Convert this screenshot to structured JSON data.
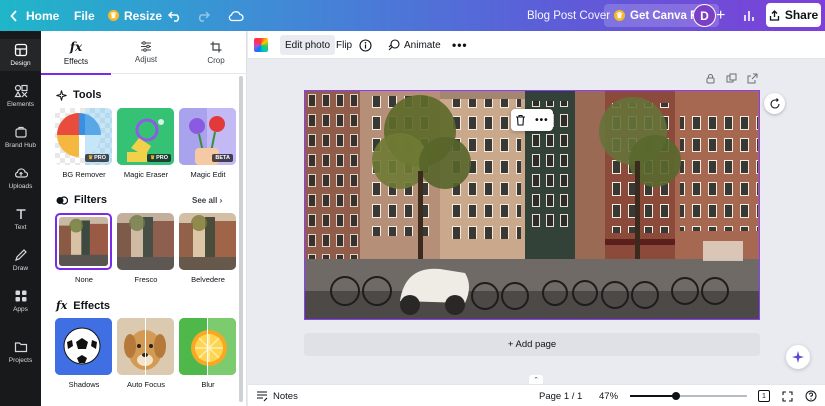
{
  "topbar": {
    "home": "Home",
    "file": "File",
    "resize": "Resize",
    "title": "Blog Post Cover",
    "get_pro": "Get Canva Pro",
    "avatar": "D",
    "share": "Share"
  },
  "rail": {
    "items": [
      {
        "label": "Design",
        "icon": "design-icon"
      },
      {
        "label": "Elements",
        "icon": "elements-icon"
      },
      {
        "label": "Brand Hub",
        "icon": "brand-hub-icon"
      },
      {
        "label": "Uploads",
        "icon": "upload-icon"
      },
      {
        "label": "Text",
        "icon": "text-icon"
      },
      {
        "label": "Draw",
        "icon": "draw-icon"
      },
      {
        "label": "Apps",
        "icon": "apps-icon"
      },
      {
        "label": "Projects",
        "icon": "folder-icon"
      }
    ]
  },
  "panel": {
    "tabs": [
      {
        "label": "Effects",
        "icon": "fx-icon"
      },
      {
        "label": "Adjust",
        "icon": "sliders-icon"
      },
      {
        "label": "Crop",
        "icon": "crop-icon"
      }
    ],
    "tools_title": "Tools",
    "tools": [
      {
        "label": "BG Remover",
        "badge": "PRO"
      },
      {
        "label": "Magic Eraser",
        "badge": "PRO"
      },
      {
        "label": "Magic Edit",
        "badge": "BETA"
      }
    ],
    "filters_title": "Filters",
    "see_all": "See all",
    "filters": [
      {
        "label": "None"
      },
      {
        "label": "Fresco"
      },
      {
        "label": "Belvedere"
      }
    ],
    "effects_title": "Effects",
    "effects": [
      {
        "label": "Shadows"
      },
      {
        "label": "Auto Focus"
      },
      {
        "label": "Blur"
      }
    ]
  },
  "context_toolbar": {
    "edit_photo": "Edit photo",
    "flip": "Flip",
    "animate": "Animate"
  },
  "canvas": {
    "add_page": "+ Add page"
  },
  "bottombar": {
    "notes": "Notes",
    "page_indicator": "Page 1 / 1",
    "zoom": "47%",
    "zoom_fraction": 0.39,
    "page_count": "1"
  },
  "colors": {
    "accent": "#7d2ae8",
    "rail_bg": "#18191b",
    "canvas_bg": "#e9ebf0"
  }
}
